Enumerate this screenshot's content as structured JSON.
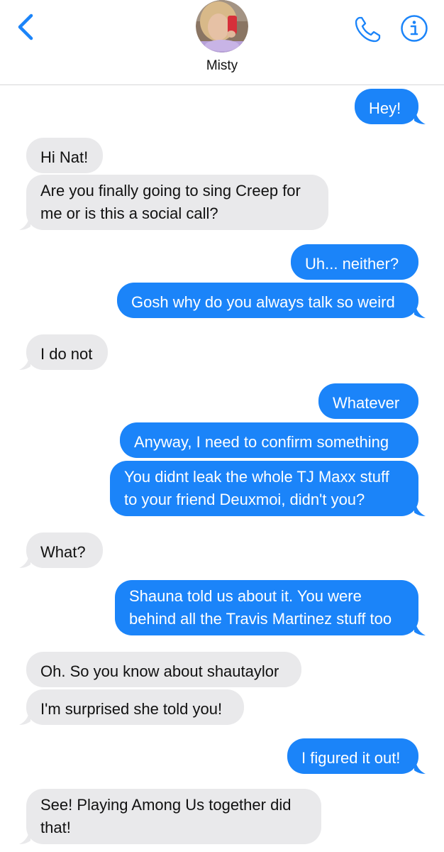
{
  "header": {
    "contact_name": "Misty",
    "accent_color": "#1b84f9"
  },
  "icons": {
    "back": "chevron-left-icon",
    "phone": "phone-icon",
    "info": "info-icon"
  },
  "messages": [
    {
      "direction": "outgoing",
      "text": "Hey!"
    },
    {
      "direction": "incoming",
      "text": "Hi Nat!"
    },
    {
      "direction": "incoming",
      "lines": [
        "Are you finally going to sing Creep for",
        "me or is this a social call?"
      ]
    },
    {
      "direction": "outgoing",
      "text": "Uh... neither?"
    },
    {
      "direction": "outgoing",
      "text": "Gosh why do you always talk so weird"
    },
    {
      "direction": "incoming",
      "text": "I do not"
    },
    {
      "direction": "outgoing",
      "text": "Whatever"
    },
    {
      "direction": "outgoing",
      "text": "Anyway, I need to confirm something"
    },
    {
      "direction": "outgoing",
      "lines": [
        "You didnt leak the whole TJ Maxx stuff",
        "to your friend Deuxmoi, didn't you?"
      ]
    },
    {
      "direction": "incoming",
      "text": "What?"
    },
    {
      "direction": "outgoing",
      "lines": [
        "Shauna told us about it. You were",
        "behind all the Travis Martinez stuff too"
      ]
    },
    {
      "direction": "incoming",
      "text": "Oh. So you know about shautaylor"
    },
    {
      "direction": "incoming",
      "text": "I'm surprised she told you!"
    },
    {
      "direction": "outgoing",
      "text": "I figured it out!"
    },
    {
      "direction": "incoming",
      "lines": [
        "See! Playing Among Us together did",
        "that!"
      ]
    }
  ]
}
